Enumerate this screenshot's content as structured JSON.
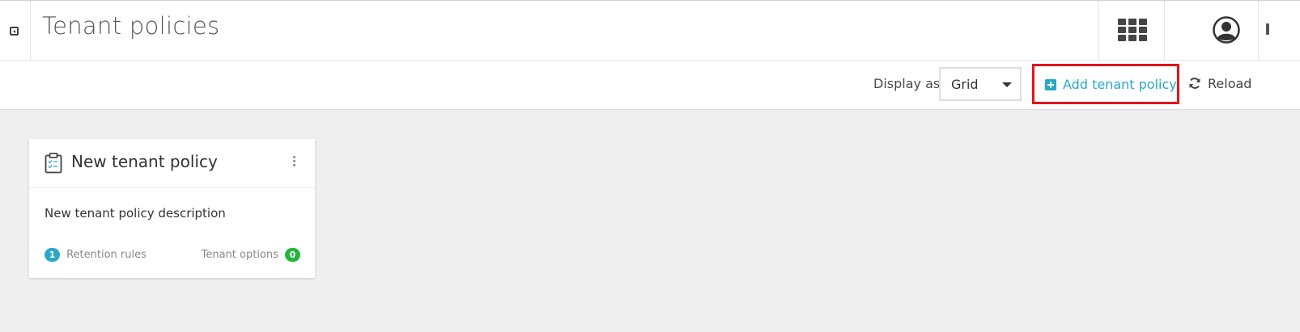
{
  "header": {
    "title": "Tenant policies",
    "icons": [
      "collapse-sidebar-icon",
      "apps-grid-icon",
      "user-avatar-icon"
    ]
  },
  "toolbar": {
    "display_label": "Display as",
    "display_value": "Grid",
    "add_label": "Add tenant policy",
    "reload_label": "Reload"
  },
  "cards": [
    {
      "title": "New tenant policy",
      "description": "New tenant policy description",
      "retention_count": "1",
      "retention_label": "Retention rules",
      "options_label": "Tenant options",
      "options_count": "0"
    }
  ],
  "colors": {
    "accent": "#29a8c9",
    "success": "#22b53c",
    "highlight": "#e3131b",
    "background": "#efefef"
  }
}
